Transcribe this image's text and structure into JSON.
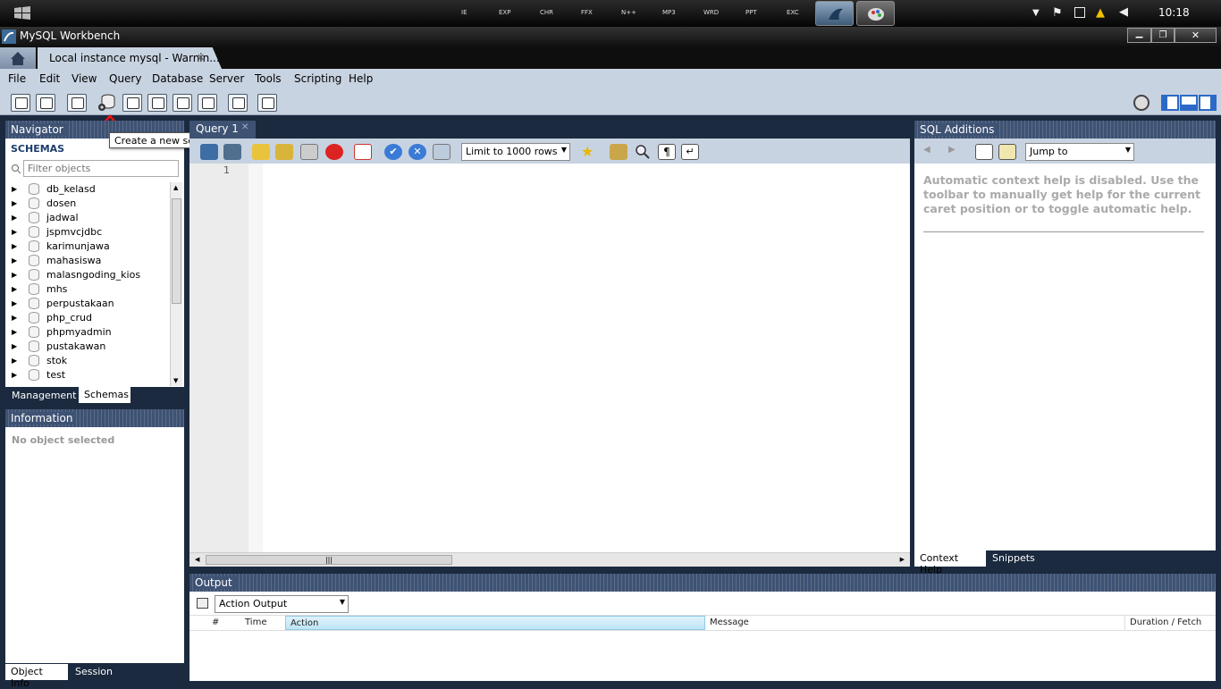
{
  "taskbar": {
    "quicklaunch": [
      "IE",
      "EXP",
      "CHR",
      "FFX",
      "N++",
      "MP3",
      "WRD",
      "PPT",
      "EXC"
    ],
    "clock": "10:18"
  },
  "window": {
    "title": "MySQL Workbench",
    "tab_label": "Local instance mysql - Warnin...",
    "tab_close": "✕"
  },
  "menu": {
    "items": [
      {
        "label": "File"
      },
      {
        "label": "Edit"
      },
      {
        "label": "View"
      },
      {
        "label": "Query"
      },
      {
        "label": "Database"
      },
      {
        "label": "Server"
      },
      {
        "label": "Tools"
      },
      {
        "label": "Scripting"
      },
      {
        "label": "Help"
      }
    ]
  },
  "tooltip": "Create a new schema in the connected server",
  "navigator": {
    "title": "Navigator",
    "schemas_label": "SCHEMAS",
    "filter_placeholder": "Filter objects",
    "schemas": [
      "db_kelasd",
      "dosen",
      "jadwal",
      "jspmvcjdbc",
      "karimunjawa",
      "mahasiswa",
      "malasngoding_kios",
      "mhs",
      "perpustakaan",
      "php_crud",
      "phpmyadmin",
      "pustakawan",
      "stok",
      "test"
    ],
    "tabs": [
      "Management",
      "Schemas"
    ]
  },
  "information": {
    "title": "Information",
    "empty_text": "No object selected",
    "tabs": [
      "Object Info",
      "Session"
    ]
  },
  "query": {
    "tab_label": "Query 1",
    "limit_value": "Limit to 1000 rows",
    "line_number": "1"
  },
  "sql_additions": {
    "title": "SQL Additions",
    "jump_to": "Jump to",
    "help_text": "Automatic context help is disabled. Use the toolbar to manually get help for the current caret position or to toggle automatic help.",
    "tabs": [
      "Context Help",
      "Snippets"
    ]
  },
  "output": {
    "title": "Output",
    "mode": "Action Output",
    "columns": [
      "#",
      "Time",
      "Action",
      "Message",
      "Duration / Fetch"
    ]
  }
}
